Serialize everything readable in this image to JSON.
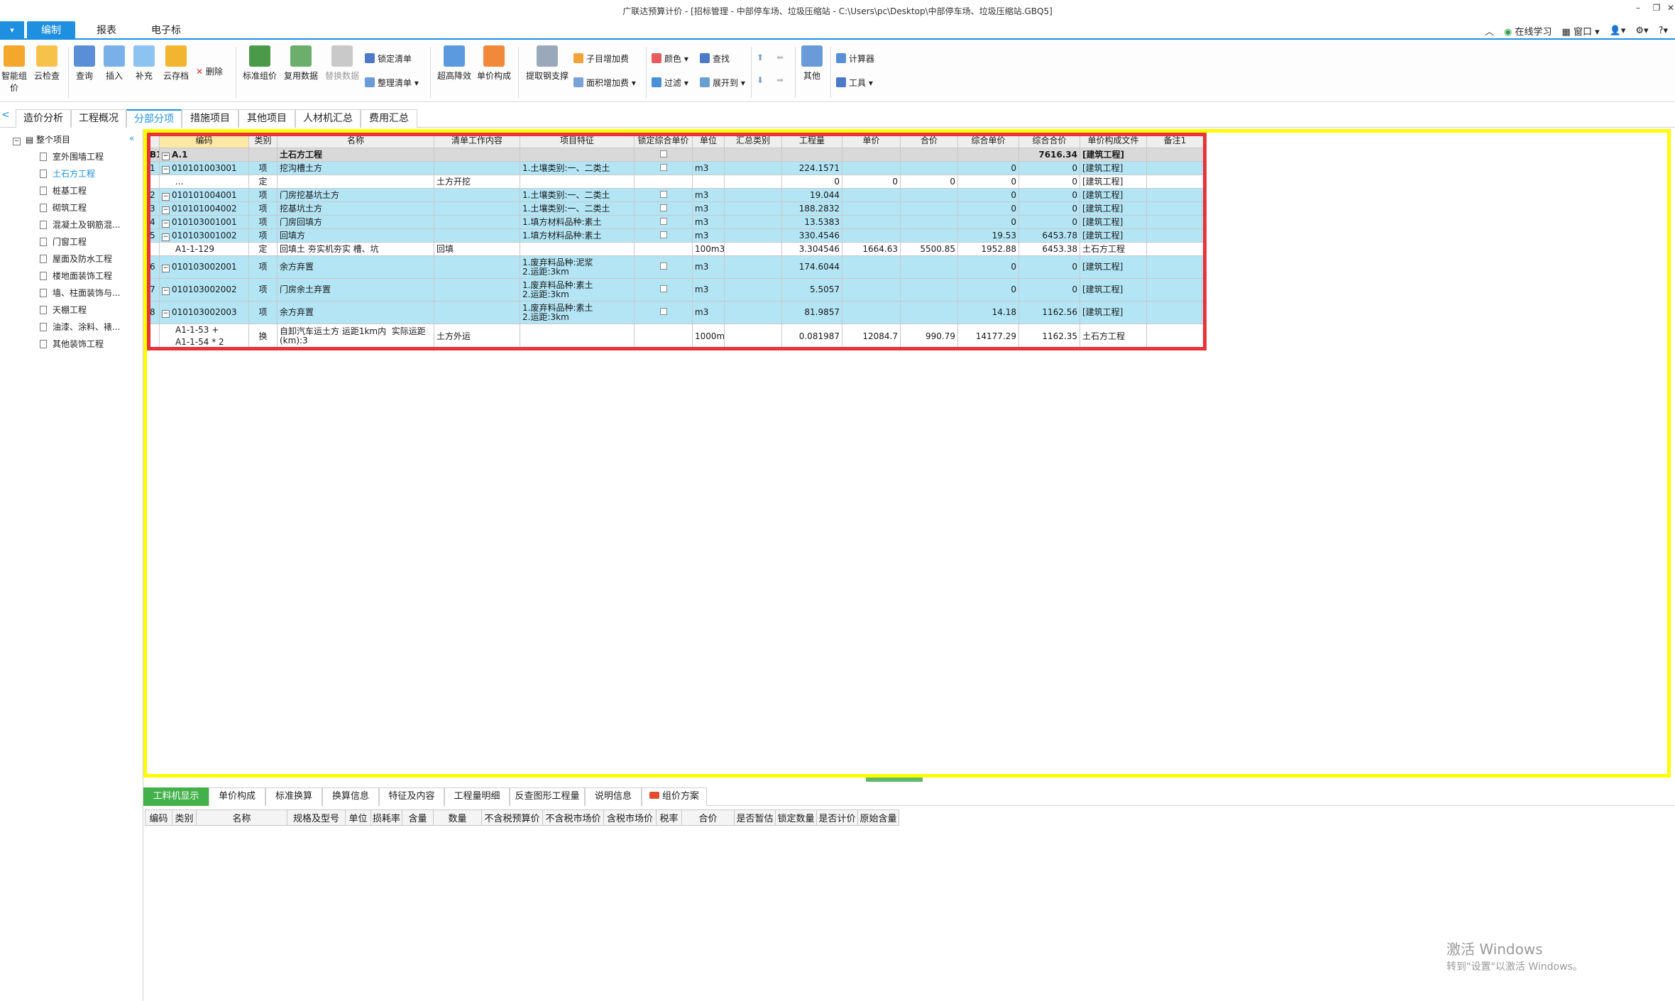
{
  "window": {
    "title": "广联达预算计价 - [招标管理 - 中部停车场、垃圾压缩站 - C:\\Users\\pc\\Desktop\\中部停车场、垃圾压缩站.GBQ5]"
  },
  "ribbon_tabs": [
    "编制",
    "报表",
    "电子标"
  ],
  "right_tools": {
    "online": "在线学习",
    "window": "窗口"
  },
  "ribbon": {
    "big": [
      "智能组价",
      "云检查",
      "查询",
      "插入",
      "补充",
      "云存档",
      "标准组价",
      "复用数据",
      "替换数据",
      "超高降效",
      "单价构成",
      "提取钢支撑",
      "其他"
    ],
    "delete": "删除",
    "small": [
      "锁定清单",
      "整理清单",
      "子目增加费",
      "面积增加费",
      "颜色",
      "查找",
      "过滤",
      "展开到",
      "计算器",
      "工具"
    ]
  },
  "module_tabs": [
    "造价分析",
    "工程概况",
    "分部分项",
    "措施项目",
    "其他项目",
    "人材机汇总",
    "费用汇总"
  ],
  "tree": {
    "root": "整个项目",
    "items": [
      "室外围墙工程",
      "土石方工程",
      "桩基工程",
      "砌筑工程",
      "混凝土及钢筋混...",
      "门窗工程",
      "屋面及防水工程",
      "楼地面装饰工程",
      "墙、柱面装饰与...",
      "天棚工程",
      "油漆、涂料、裱...",
      "其他装饰工程"
    ]
  },
  "grid": {
    "headers": [
      "",
      "编码",
      "类别",
      "名称",
      "清单工作内容",
      "项目特征",
      "锁定综合单价",
      "单位",
      "汇总类别",
      "工程量",
      "单价",
      "合价",
      "综合单价",
      "综合合价",
      "单价构成文件",
      "备注1"
    ],
    "rows": [
      {
        "kind": "sec",
        "idx": "B1",
        "code": "A.1",
        "type": "",
        "name": "土石方工程",
        "work": "",
        "feat": "",
        "chk": true,
        "unit": "",
        "sum": "",
        "qty": "",
        "price": "",
        "total": "",
        "cprice": "",
        "ctotal": "7616.34",
        "file": "[建筑工程]"
      },
      {
        "kind": "item",
        "idx": "1",
        "code": "010101003001",
        "type": "项",
        "name": "挖沟槽土方",
        "work": "",
        "feat": "1.土壤类别:一、二类土",
        "chk": true,
        "unit": "m3",
        "sum": "",
        "qty": "224.1571",
        "price": "",
        "total": "",
        "cprice": "0",
        "ctotal": "0",
        "file": "[建筑工程]"
      },
      {
        "kind": "quota",
        "idx": "",
        "code": "...",
        "type": "定",
        "name": "",
        "work": "土方开挖",
        "feat": "",
        "chk": false,
        "unit": "",
        "sum": "",
        "qty": "0",
        "price": "0",
        "total": "0",
        "cprice": "0",
        "ctotal": "0",
        "file": "[建筑工程]"
      },
      {
        "kind": "item",
        "idx": "2",
        "code": "010101004001",
        "type": "项",
        "name": "门房挖基坑土方",
        "work": "",
        "feat": "1.土壤类别:一、二类土",
        "chk": true,
        "unit": "m3",
        "sum": "",
        "qty": "19.044",
        "price": "",
        "total": "",
        "cprice": "0",
        "ctotal": "0",
        "file": "[建筑工程]"
      },
      {
        "kind": "item",
        "idx": "3",
        "code": "010101004002",
        "type": "项",
        "name": "挖基坑土方",
        "work": "",
        "feat": "1.土壤类别:一、二类土",
        "chk": true,
        "unit": "m3",
        "sum": "",
        "qty": "188.2832",
        "price": "",
        "total": "",
        "cprice": "0",
        "ctotal": "0",
        "file": "[建筑工程]"
      },
      {
        "kind": "item",
        "idx": "4",
        "code": "010103001001",
        "type": "项",
        "name": "门房回填方",
        "work": "",
        "feat": "1.填方材料品种:素土",
        "chk": true,
        "unit": "m3",
        "sum": "",
        "qty": "13.5383",
        "price": "",
        "total": "",
        "cprice": "0",
        "ctotal": "0",
        "file": "[建筑工程]"
      },
      {
        "kind": "item",
        "idx": "5",
        "code": "010103001002",
        "type": "项",
        "name": "回填方",
        "work": "",
        "feat": "1.填方材料品种:素土",
        "chk": true,
        "unit": "m3",
        "sum": "",
        "qty": "330.4546",
        "price": "",
        "total": "",
        "cprice": "19.53",
        "ctotal": "6453.78",
        "file": "[建筑工程]"
      },
      {
        "kind": "quota",
        "idx": "",
        "code": "A1-1-129",
        "type": "定",
        "name": "回填土 夯实机夯实 槽、坑",
        "work": "回填",
        "feat": "",
        "chk": false,
        "unit": "100m3",
        "sum": "",
        "qty": "3.304546",
        "price": "1664.63",
        "total": "5500.85",
        "cprice": "1952.88",
        "ctotal": "6453.38",
        "file": "土石方工程"
      },
      {
        "kind": "item",
        "idx": "6",
        "code": "010103002001",
        "type": "项",
        "name": "余方弃置",
        "work": "",
        "feat": "1.废弃料品种:泥浆\n2.运距:3km",
        "chk": true,
        "unit": "m3",
        "sum": "",
        "qty": "174.6044",
        "price": "",
        "total": "",
        "cprice": "0",
        "ctotal": "0",
        "file": "[建筑工程]",
        "tall": true
      },
      {
        "kind": "item",
        "idx": "7",
        "code": "010103002002",
        "type": "项",
        "name": "门房余土弃置",
        "work": "",
        "feat": "1.废弃料品种:素土\n2.运距:3km",
        "chk": true,
        "unit": "m3",
        "sum": "",
        "qty": "5.5057",
        "price": "",
        "total": "",
        "cprice": "0",
        "ctotal": "0",
        "file": "[建筑工程]",
        "tall": true
      },
      {
        "kind": "item",
        "idx": "8",
        "code": "010103002003",
        "type": "项",
        "name": "余方弃置",
        "work": "",
        "feat": "1.废弃料品种:素土\n2.运距:3km",
        "chk": true,
        "unit": "m3",
        "sum": "",
        "qty": "81.9857",
        "price": "",
        "total": "",
        "cprice": "14.18",
        "ctotal": "1162.56",
        "file": "[建筑工程]",
        "tall": true
      },
      {
        "kind": "quota",
        "idx": "",
        "code": "A1-1-53 +\nA1-1-54 * 2",
        "type": "换",
        "name": "自卸汽车运土方 运距1km内  实际运距\n(km):3",
        "work": "土方外运",
        "feat": "",
        "chk": false,
        "unit": "1000m3",
        "sum": "",
        "qty": "0.081987",
        "price": "12084.7",
        "total": "990.79",
        "cprice": "14177.29",
        "ctotal": "1162.35",
        "file": "土石方工程",
        "tall": true
      }
    ]
  },
  "bottom_tabs": [
    "工料机显示",
    "单价构成",
    "标准换算",
    "换算信息",
    "特征及内容",
    "工程量明细",
    "反查图形工程量",
    "说明信息",
    "组价方案"
  ],
  "bottom_headers": [
    "编码",
    "类别",
    "名称",
    "规格及型号",
    "单位",
    "损耗率",
    "含量",
    "数量",
    "不含税预算价",
    "不含税市场价",
    "含税市场价",
    "税率",
    "合价",
    "是否暂估",
    "锁定数量",
    "是否计价",
    "原始含量"
  ],
  "watermark": {
    "line1": "激活 Windows",
    "line2": "转到\"设置\"以激活 Windows。"
  }
}
